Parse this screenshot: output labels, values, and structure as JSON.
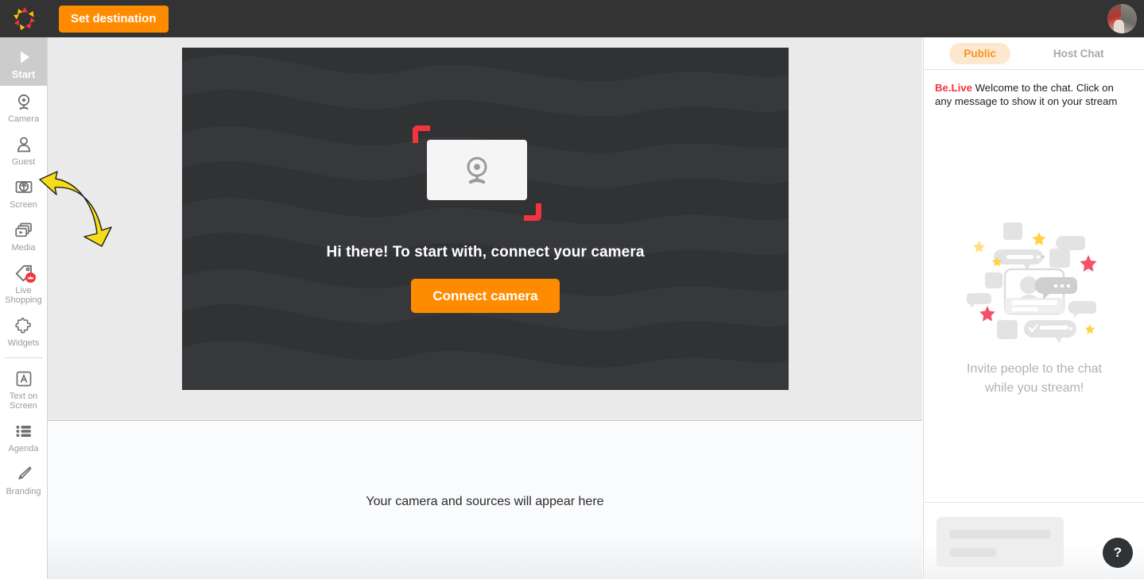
{
  "topbar": {
    "logo_name": "be-live-logo",
    "set_destination_label": "Set destination",
    "avatar_name": "user-avatar"
  },
  "sidebar": {
    "items": [
      {
        "label": "Start",
        "icon": "play-icon",
        "active": true
      },
      {
        "label": "Camera",
        "icon": "webcam-icon",
        "active": false
      },
      {
        "label": "Guest",
        "icon": "person-icon",
        "active": false
      },
      {
        "label": "Screen",
        "icon": "screen-share-icon",
        "active": false
      },
      {
        "label": "Media",
        "icon": "media-stack-icon",
        "active": false
      },
      {
        "label": "Live Shopping",
        "icon": "price-tag-icon",
        "active": false,
        "badge": true
      },
      {
        "label": "Widgets",
        "icon": "puzzle-piece-icon",
        "active": false
      },
      {
        "label": "Text on Screen",
        "icon": "text-box-icon",
        "active": false
      },
      {
        "label": "Agenda",
        "icon": "agenda-list-icon",
        "active": false
      },
      {
        "label": "Branding",
        "icon": "paint-brush-icon",
        "active": false
      }
    ]
  },
  "stage": {
    "headline": "Hi there! To start with, connect your camera",
    "connect_button": "Connect camera",
    "camera_icon": "webcam-placeholder-icon"
  },
  "bottom_panel": {
    "placeholder_text": "Your camera and sources will appear here"
  },
  "chat": {
    "tabs": [
      {
        "label": "Public",
        "active": true
      },
      {
        "label": "Host Chat",
        "active": false
      }
    ],
    "message": {
      "sender": "Be.Live",
      "text": "Welcome to the chat. Click on any message to show it on your stream"
    },
    "empty_state": {
      "line1": "Invite people to the chat",
      "line2": "while you stream!",
      "illustration": "chat-bubbles-illustration"
    },
    "help_button_label": "?"
  },
  "annotation": {
    "arrow": "yellow-curved-arrow-pointing-to-screen"
  },
  "colors": {
    "brand_orange": "#ff8c00",
    "tab_orange": "#f7931e",
    "tab_pill_bg": "#fde8cf",
    "brand_red": "#f5333f",
    "topbar_dark": "#333333",
    "stage_gray": "#eaeaea",
    "video_dark": "#303234",
    "sidebar_active": "#cccccc",
    "annotation_yellow": "#f5dc19"
  }
}
